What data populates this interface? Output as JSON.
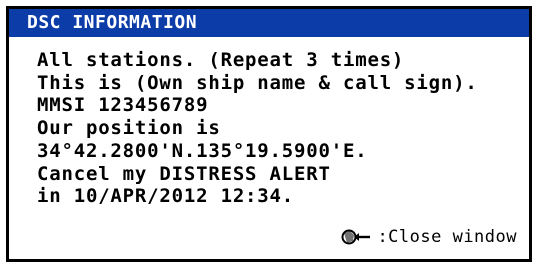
{
  "window": {
    "title": "DSC INFORMATION"
  },
  "message": {
    "lines": [
      "All stations. (Repeat 3 times)",
      "This is (Own ship name & call sign).",
      "MMSI 123456789",
      "Our position is",
      "34°42.2800'N.135°19.5900'E.",
      "Cancel my DISTRESS ALERT",
      "in 10/APR/2012 12:34."
    ]
  },
  "footer": {
    "icon": "enter-knob-icon",
    "close_label": ":Close window"
  }
}
